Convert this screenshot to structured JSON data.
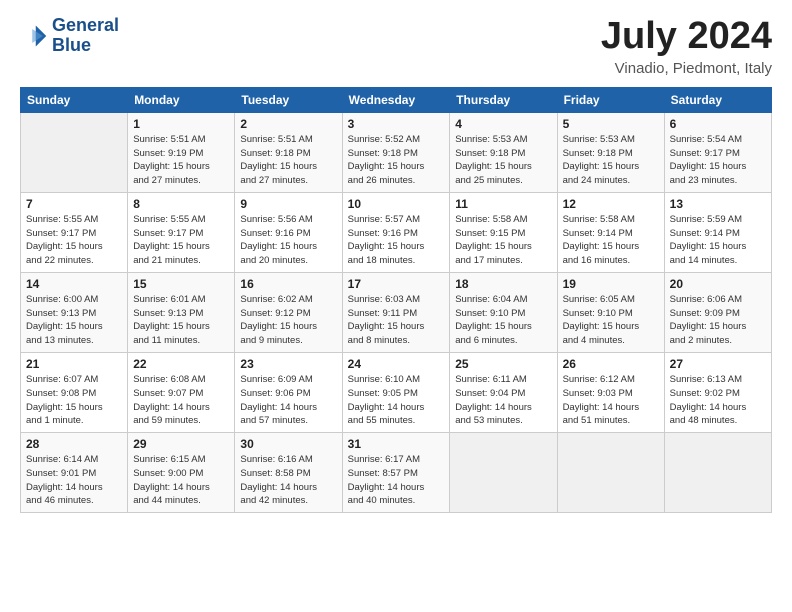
{
  "header": {
    "logo_line1": "General",
    "logo_line2": "Blue",
    "month_year": "July 2024",
    "location": "Vinadio, Piedmont, Italy"
  },
  "weekdays": [
    "Sunday",
    "Monday",
    "Tuesday",
    "Wednesday",
    "Thursday",
    "Friday",
    "Saturday"
  ],
  "weeks": [
    [
      {
        "day": "",
        "info": ""
      },
      {
        "day": "1",
        "info": "Sunrise: 5:51 AM\nSunset: 9:19 PM\nDaylight: 15 hours\nand 27 minutes."
      },
      {
        "day": "2",
        "info": "Sunrise: 5:51 AM\nSunset: 9:18 PM\nDaylight: 15 hours\nand 27 minutes."
      },
      {
        "day": "3",
        "info": "Sunrise: 5:52 AM\nSunset: 9:18 PM\nDaylight: 15 hours\nand 26 minutes."
      },
      {
        "day": "4",
        "info": "Sunrise: 5:53 AM\nSunset: 9:18 PM\nDaylight: 15 hours\nand 25 minutes."
      },
      {
        "day": "5",
        "info": "Sunrise: 5:53 AM\nSunset: 9:18 PM\nDaylight: 15 hours\nand 24 minutes."
      },
      {
        "day": "6",
        "info": "Sunrise: 5:54 AM\nSunset: 9:17 PM\nDaylight: 15 hours\nand 23 minutes."
      }
    ],
    [
      {
        "day": "7",
        "info": "Sunrise: 5:55 AM\nSunset: 9:17 PM\nDaylight: 15 hours\nand 22 minutes."
      },
      {
        "day": "8",
        "info": "Sunrise: 5:55 AM\nSunset: 9:17 PM\nDaylight: 15 hours\nand 21 minutes."
      },
      {
        "day": "9",
        "info": "Sunrise: 5:56 AM\nSunset: 9:16 PM\nDaylight: 15 hours\nand 20 minutes."
      },
      {
        "day": "10",
        "info": "Sunrise: 5:57 AM\nSunset: 9:16 PM\nDaylight: 15 hours\nand 18 minutes."
      },
      {
        "day": "11",
        "info": "Sunrise: 5:58 AM\nSunset: 9:15 PM\nDaylight: 15 hours\nand 17 minutes."
      },
      {
        "day": "12",
        "info": "Sunrise: 5:58 AM\nSunset: 9:14 PM\nDaylight: 15 hours\nand 16 minutes."
      },
      {
        "day": "13",
        "info": "Sunrise: 5:59 AM\nSunset: 9:14 PM\nDaylight: 15 hours\nand 14 minutes."
      }
    ],
    [
      {
        "day": "14",
        "info": "Sunrise: 6:00 AM\nSunset: 9:13 PM\nDaylight: 15 hours\nand 13 minutes."
      },
      {
        "day": "15",
        "info": "Sunrise: 6:01 AM\nSunset: 9:13 PM\nDaylight: 15 hours\nand 11 minutes."
      },
      {
        "day": "16",
        "info": "Sunrise: 6:02 AM\nSunset: 9:12 PM\nDaylight: 15 hours\nand 9 minutes."
      },
      {
        "day": "17",
        "info": "Sunrise: 6:03 AM\nSunset: 9:11 PM\nDaylight: 15 hours\nand 8 minutes."
      },
      {
        "day": "18",
        "info": "Sunrise: 6:04 AM\nSunset: 9:10 PM\nDaylight: 15 hours\nand 6 minutes."
      },
      {
        "day": "19",
        "info": "Sunrise: 6:05 AM\nSunset: 9:10 PM\nDaylight: 15 hours\nand 4 minutes."
      },
      {
        "day": "20",
        "info": "Sunrise: 6:06 AM\nSunset: 9:09 PM\nDaylight: 15 hours\nand 2 minutes."
      }
    ],
    [
      {
        "day": "21",
        "info": "Sunrise: 6:07 AM\nSunset: 9:08 PM\nDaylight: 15 hours\nand 1 minute."
      },
      {
        "day": "22",
        "info": "Sunrise: 6:08 AM\nSunset: 9:07 PM\nDaylight: 14 hours\nand 59 minutes."
      },
      {
        "day": "23",
        "info": "Sunrise: 6:09 AM\nSunset: 9:06 PM\nDaylight: 14 hours\nand 57 minutes."
      },
      {
        "day": "24",
        "info": "Sunrise: 6:10 AM\nSunset: 9:05 PM\nDaylight: 14 hours\nand 55 minutes."
      },
      {
        "day": "25",
        "info": "Sunrise: 6:11 AM\nSunset: 9:04 PM\nDaylight: 14 hours\nand 53 minutes."
      },
      {
        "day": "26",
        "info": "Sunrise: 6:12 AM\nSunset: 9:03 PM\nDaylight: 14 hours\nand 51 minutes."
      },
      {
        "day": "27",
        "info": "Sunrise: 6:13 AM\nSunset: 9:02 PM\nDaylight: 14 hours\nand 48 minutes."
      }
    ],
    [
      {
        "day": "28",
        "info": "Sunrise: 6:14 AM\nSunset: 9:01 PM\nDaylight: 14 hours\nand 46 minutes."
      },
      {
        "day": "29",
        "info": "Sunrise: 6:15 AM\nSunset: 9:00 PM\nDaylight: 14 hours\nand 44 minutes."
      },
      {
        "day": "30",
        "info": "Sunrise: 6:16 AM\nSunset: 8:58 PM\nDaylight: 14 hours\nand 42 minutes."
      },
      {
        "day": "31",
        "info": "Sunrise: 6:17 AM\nSunset: 8:57 PM\nDaylight: 14 hours\nand 40 minutes."
      },
      {
        "day": "",
        "info": ""
      },
      {
        "day": "",
        "info": ""
      },
      {
        "day": "",
        "info": ""
      }
    ]
  ]
}
